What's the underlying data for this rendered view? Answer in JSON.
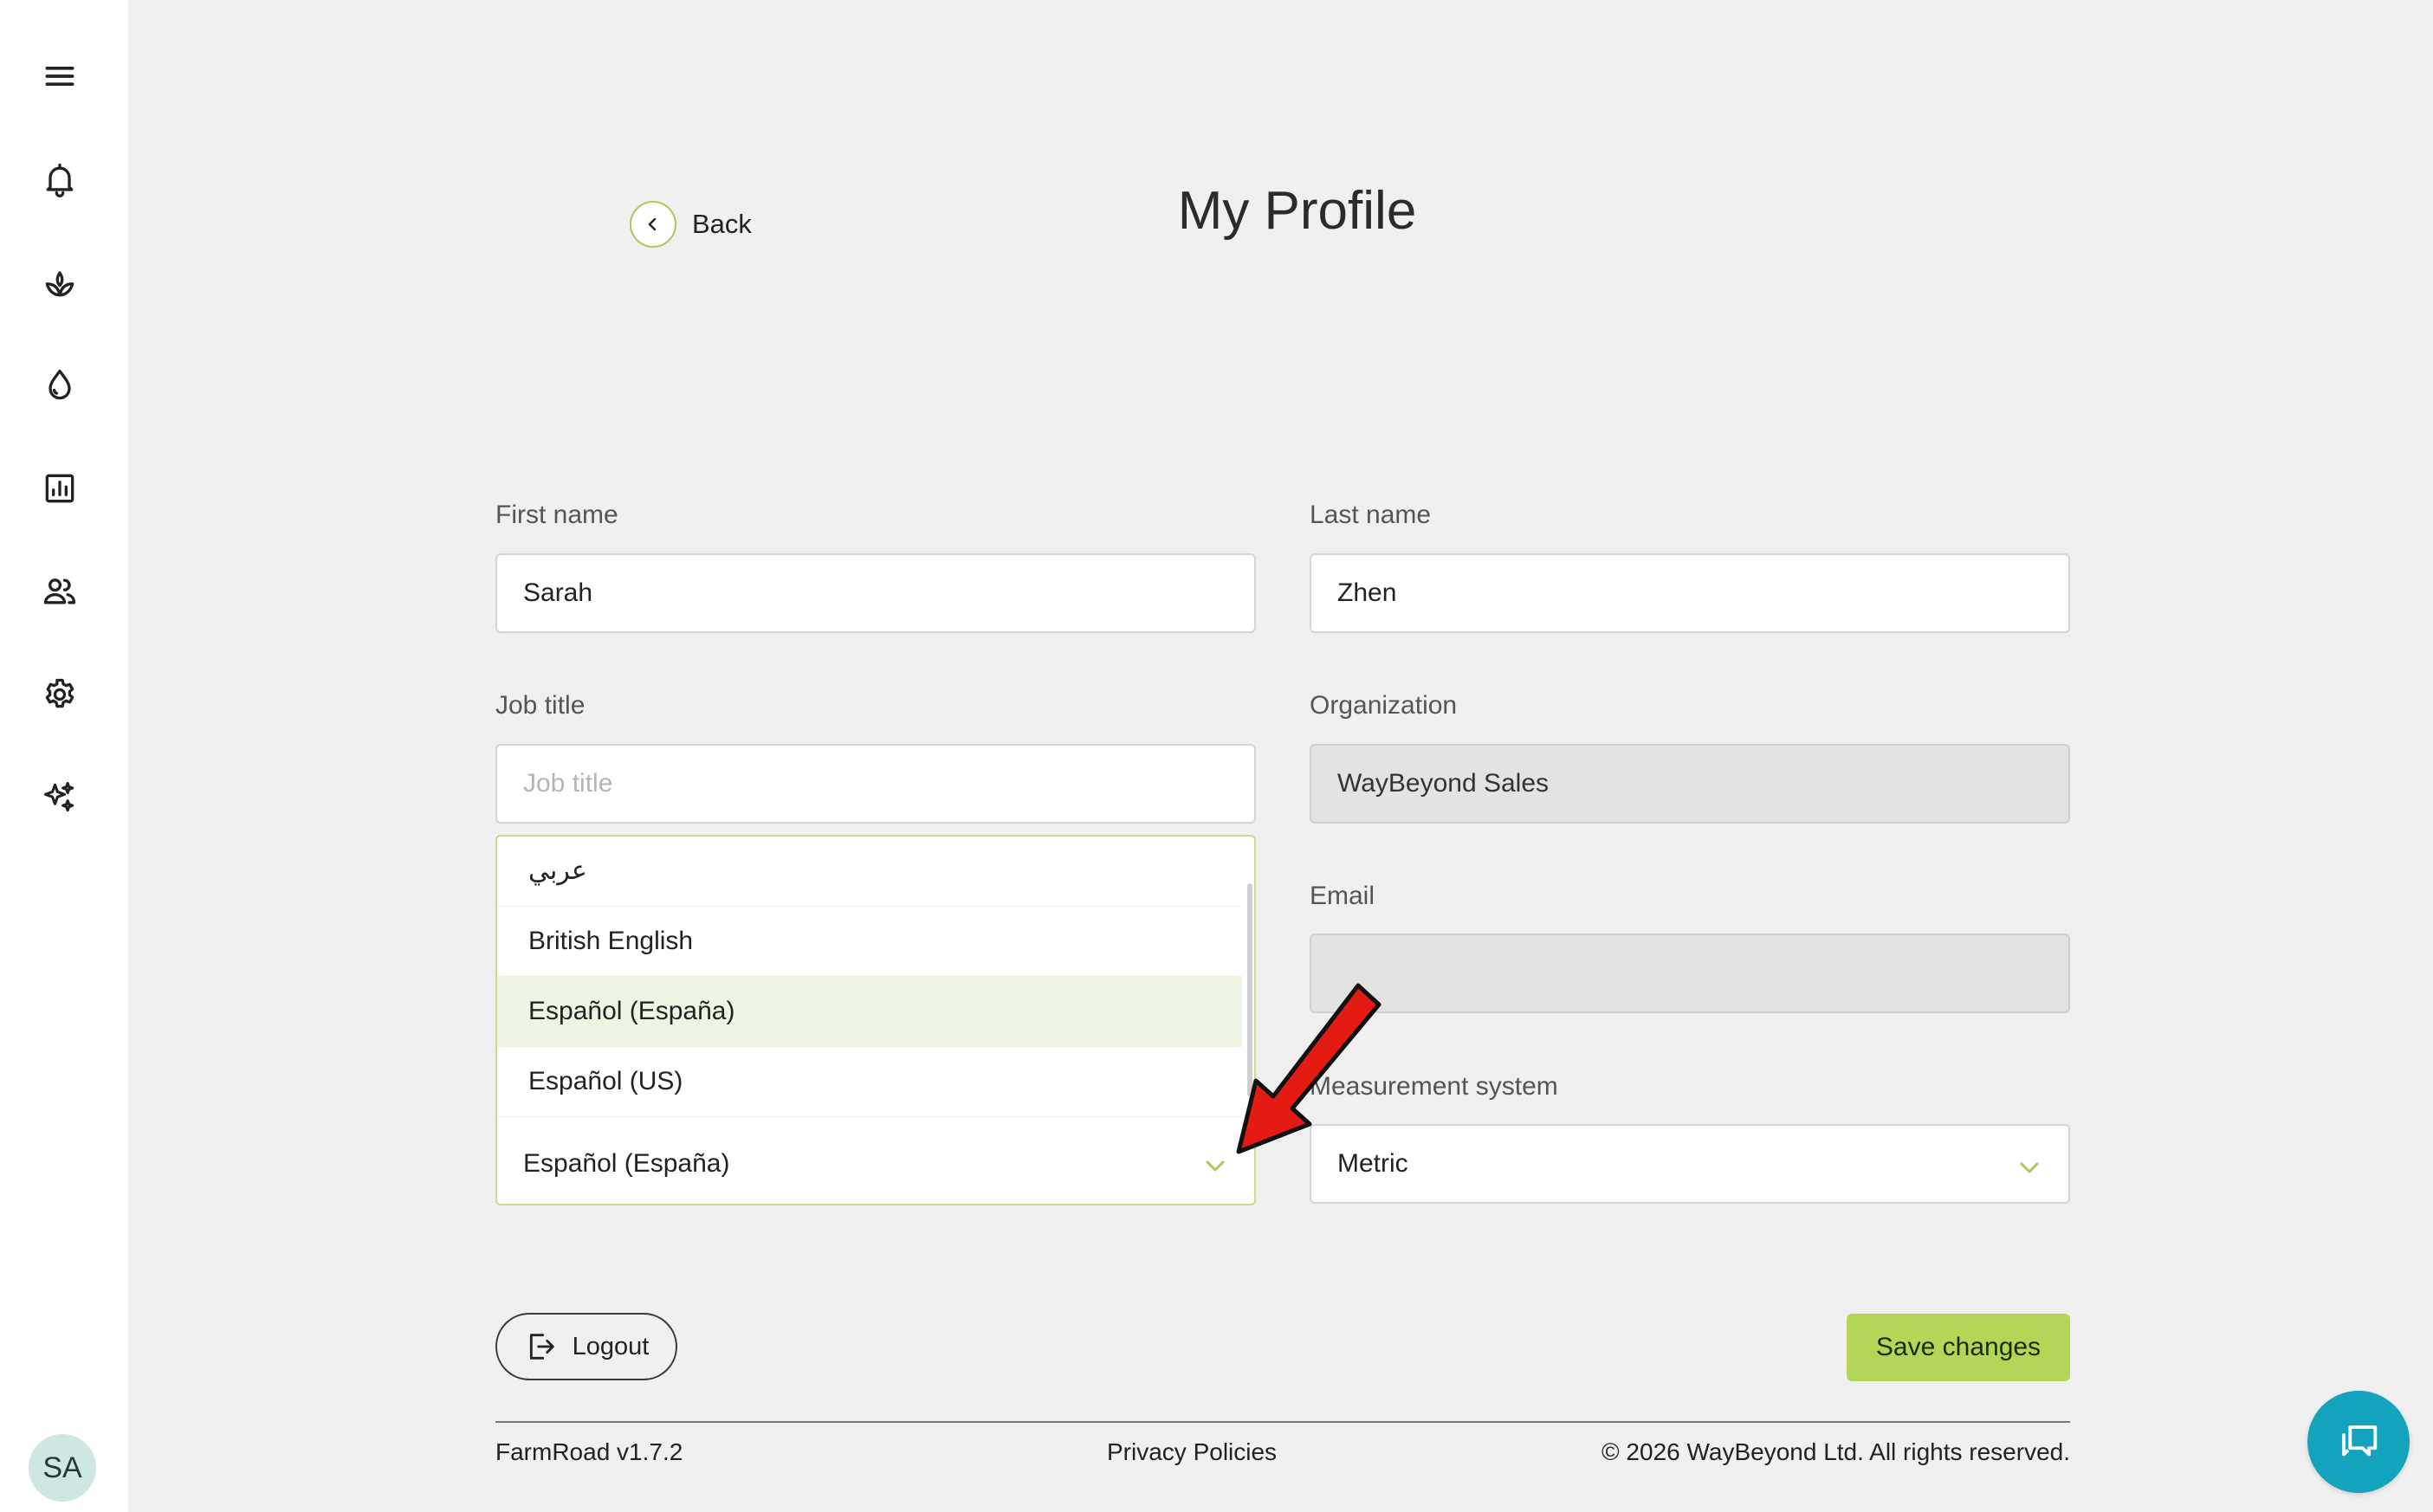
{
  "sidebar": {
    "items": [
      {
        "name": "menu"
      },
      {
        "name": "notifications"
      },
      {
        "name": "plants"
      },
      {
        "name": "water"
      },
      {
        "name": "reports"
      },
      {
        "name": "users"
      },
      {
        "name": "settings"
      },
      {
        "name": "ai-assistant"
      }
    ],
    "avatar_initials": "SA"
  },
  "header": {
    "back_label": "Back",
    "title": "My Profile"
  },
  "form": {
    "first_name": {
      "label": "First name",
      "value": "Sarah"
    },
    "last_name": {
      "label": "Last name",
      "value": "Zhen"
    },
    "job_title": {
      "label": "Job title",
      "value": "",
      "placeholder": "Job title"
    },
    "organization": {
      "label": "Organization",
      "value": "WayBeyond Sales"
    },
    "email": {
      "label": "Email",
      "value": ""
    },
    "language": {
      "value": "Español (España)",
      "options": [
        "عربي",
        "British English",
        "Español (España)",
        "Español (US)"
      ],
      "selected_option": "Español (España)"
    },
    "measurement": {
      "label": "Measurement system",
      "value": "Metric"
    }
  },
  "actions": {
    "logout_label": "Logout",
    "save_label": "Save changes"
  },
  "footer": {
    "version": "FarmRoad v1.7.2",
    "privacy": "Privacy Policies",
    "copyright": "© 2026 WayBeyond Ltd. All rights reserved."
  },
  "colors": {
    "accent": "#b3d657",
    "chat": "#14a3bd",
    "arrow": "#e41b13"
  }
}
